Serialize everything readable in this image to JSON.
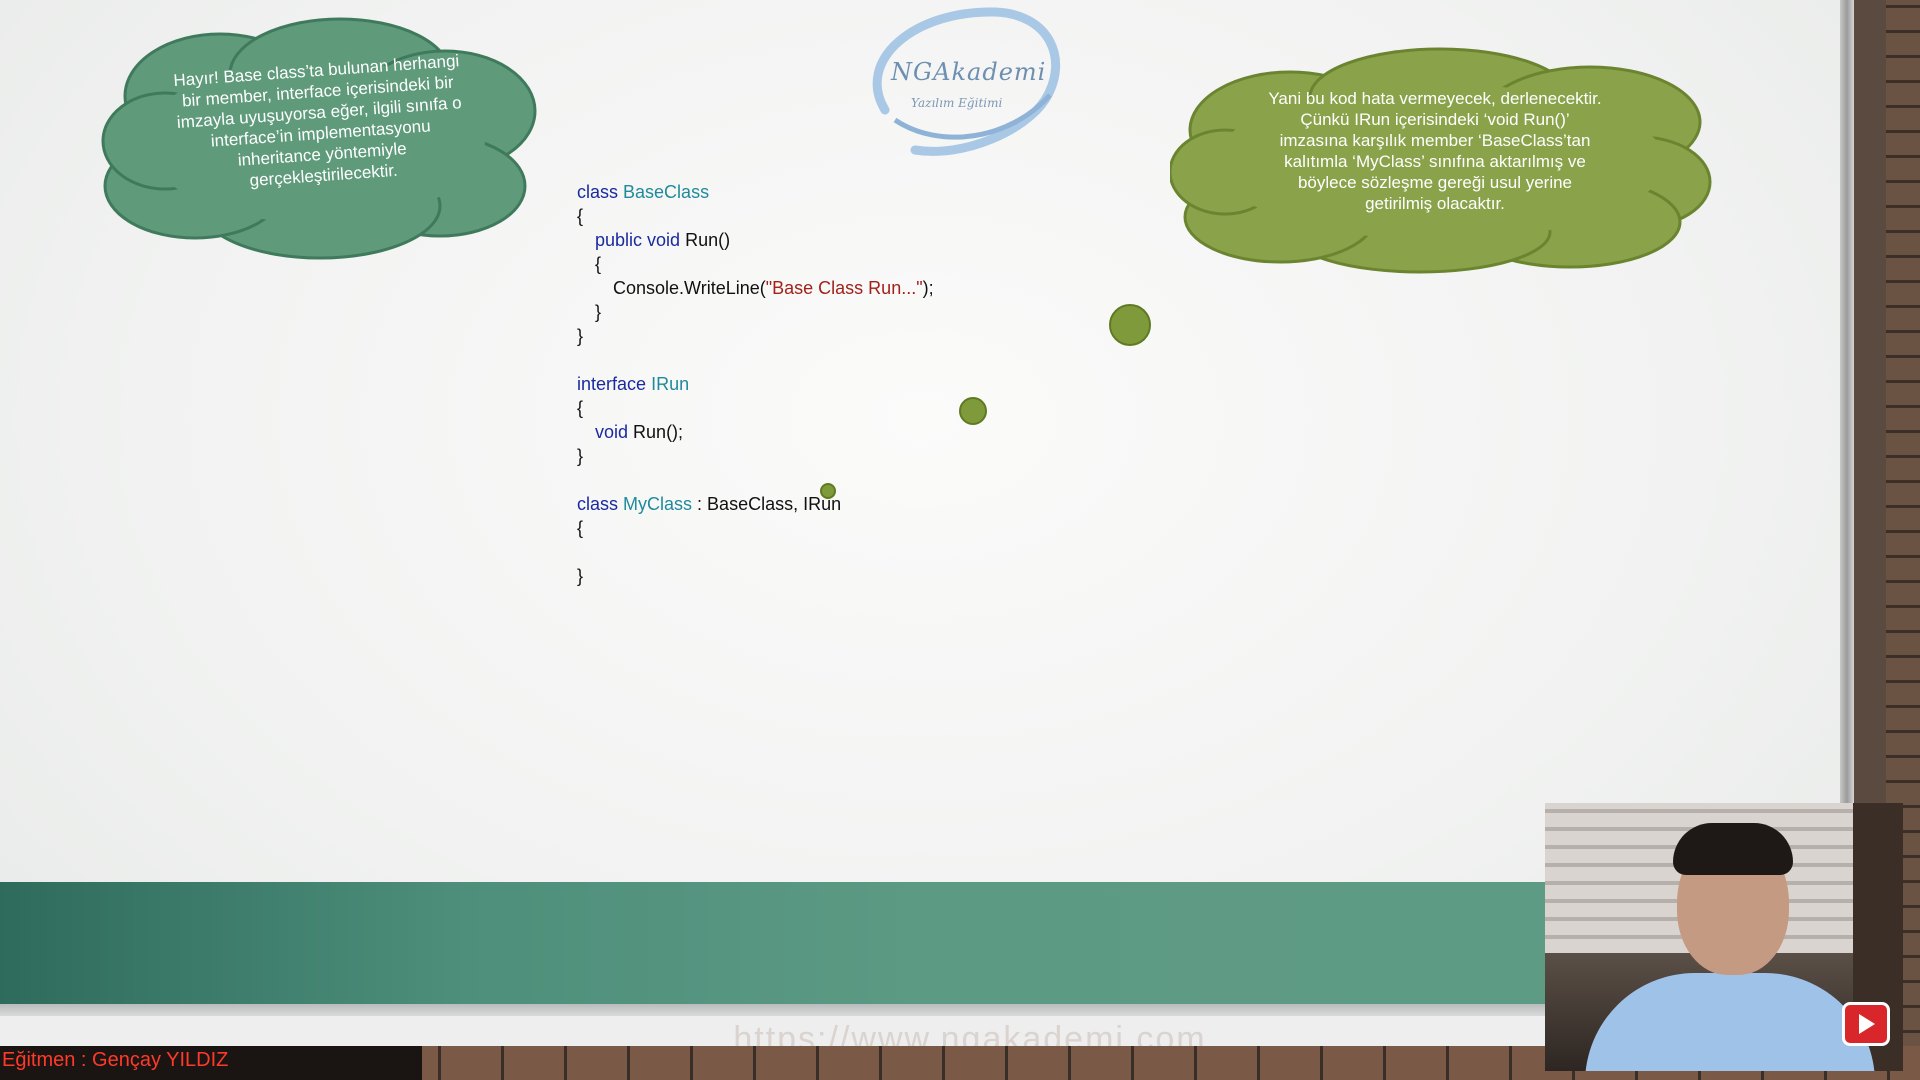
{
  "left_cloud": {
    "text": "Hayır! Base class’ta bulunan herhangi bir member, interface içerisindeki bir imzayla uyuşuyorsa eğer, ilgili sınıfa o interface’in implementasyonu inheritance yöntemiyle gerçekleştirilecektir.",
    "color": "#5f9b7b"
  },
  "right_cloud": {
    "text": "Yani bu kod hata vermeyecek, derlenecektir. Çünkü IRun içerisindeki ‘void Run()’ imzasına karşılık member ‘BaseClass’tan kalıtımla ‘MyClass’ sınıfına aktarılmış ve böylece sözleşme gereği usul yerine getirilmiş olacaktır.",
    "color": "#8aa34a"
  },
  "logo": {
    "name": "NGAkademi",
    "subtitle": "Yazılım Eğitimi"
  },
  "code": {
    "line1": {
      "kw": "class",
      "type": "BaseClass"
    },
    "line2": "{",
    "line3": {
      "kw": "public void",
      "rest": "Run()"
    },
    "line4": "{",
    "line5": {
      "pre": "Console.WriteLine(",
      "str": "\"Base Class Run...\"",
      "post": ");"
    },
    "line6": "}",
    "line7": "}",
    "line9": {
      "kw": "interface",
      "type": "IRun"
    },
    "line10": "{",
    "line11": {
      "kw": "void",
      "rest": "Run();"
    },
    "line12": "}",
    "line14": {
      "kw": "class",
      "type": "MyClass",
      "rest": " : BaseClass, IRun"
    },
    "line15": "{",
    "line17": "}"
  },
  "footer": {
    "instructor": "Eğitmen : Gençay YILDIZ",
    "watermark": "https://www.ngakademi.com"
  },
  "colors": {
    "keyword": "#1a2aa0",
    "type": "#208a9c",
    "string": "#a3211a",
    "band": "#5e9b85",
    "instructor_text": "#ff3a2a"
  },
  "icons": {
    "youtube": "youtube-play-icon"
  }
}
